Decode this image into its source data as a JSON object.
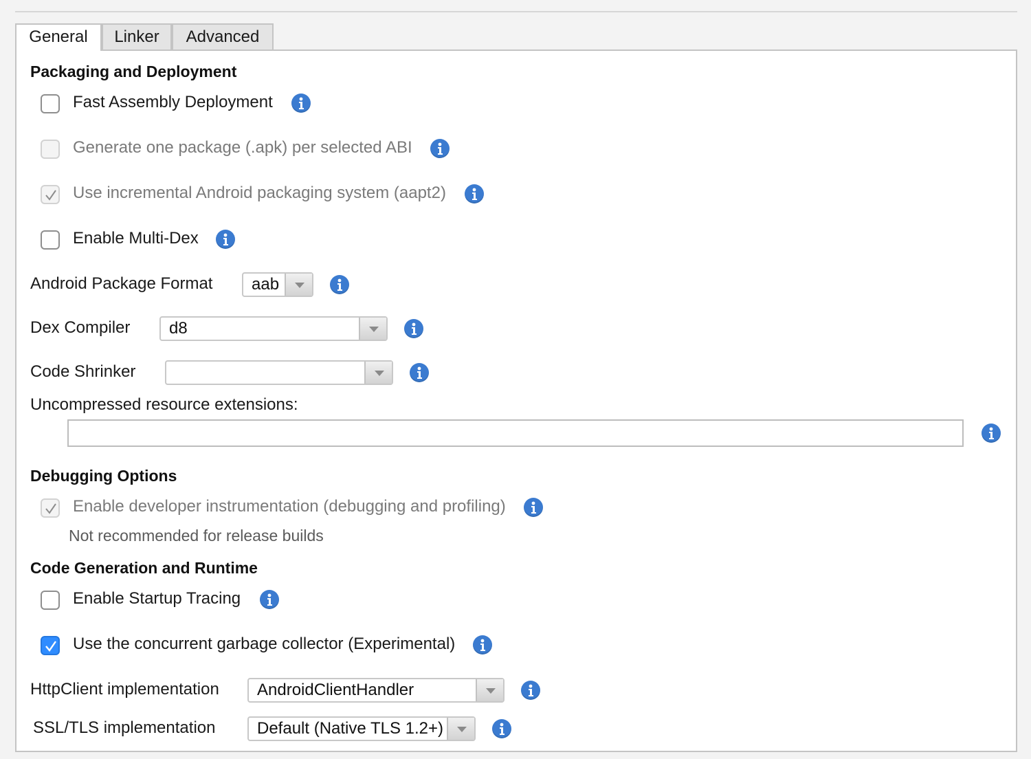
{
  "tabs": [
    {
      "label": "General",
      "active": true
    },
    {
      "label": "Linker",
      "active": false
    },
    {
      "label": "Advanced",
      "active": false
    }
  ],
  "packaging": {
    "title": "Packaging and Deployment",
    "fast_assembly": {
      "label": "Fast Assembly Deployment",
      "checked": false,
      "enabled": true
    },
    "one_package_per_abi": {
      "label": "Generate one package (.apk) per selected ABI",
      "checked": false,
      "enabled": false
    },
    "aapt2": {
      "label": "Use incremental Android packaging system (aapt2)",
      "checked": true,
      "enabled": false
    },
    "multidex": {
      "label": "Enable Multi-Dex",
      "checked": false,
      "enabled": true
    },
    "package_format": {
      "label": "Android Package Format",
      "value": "aab"
    },
    "dex_compiler": {
      "label": "Dex Compiler",
      "value": "d8"
    },
    "code_shrinker": {
      "label": "Code Shrinker",
      "value": ""
    },
    "uncompressed_ext": {
      "label": "Uncompressed resource extensions:",
      "value": ""
    }
  },
  "debugging": {
    "title": "Debugging Options",
    "dev_instrumentation": {
      "label": "Enable developer instrumentation (debugging and profiling)",
      "checked": true,
      "enabled": false
    },
    "note": "Not recommended for release builds"
  },
  "codegen": {
    "title": "Code Generation and Runtime",
    "startup_tracing": {
      "label": "Enable Startup Tracing",
      "checked": false,
      "enabled": true
    },
    "concurrent_gc": {
      "label": "Use the concurrent garbage collector (Experimental)",
      "checked": true,
      "enabled": true
    },
    "httpclient": {
      "label": "HttpClient implementation",
      "value": "AndroidClientHandler"
    },
    "ssl_tls": {
      "label": "SSL/TLS implementation",
      "value": "Default (Native TLS 1.2+)"
    }
  },
  "icons": {
    "info": "info-icon",
    "dropdown": "chevron-down-icon",
    "check": "checkmark-icon"
  },
  "colors": {
    "accent": "#2f8cff",
    "info": "#3b7bd0"
  }
}
